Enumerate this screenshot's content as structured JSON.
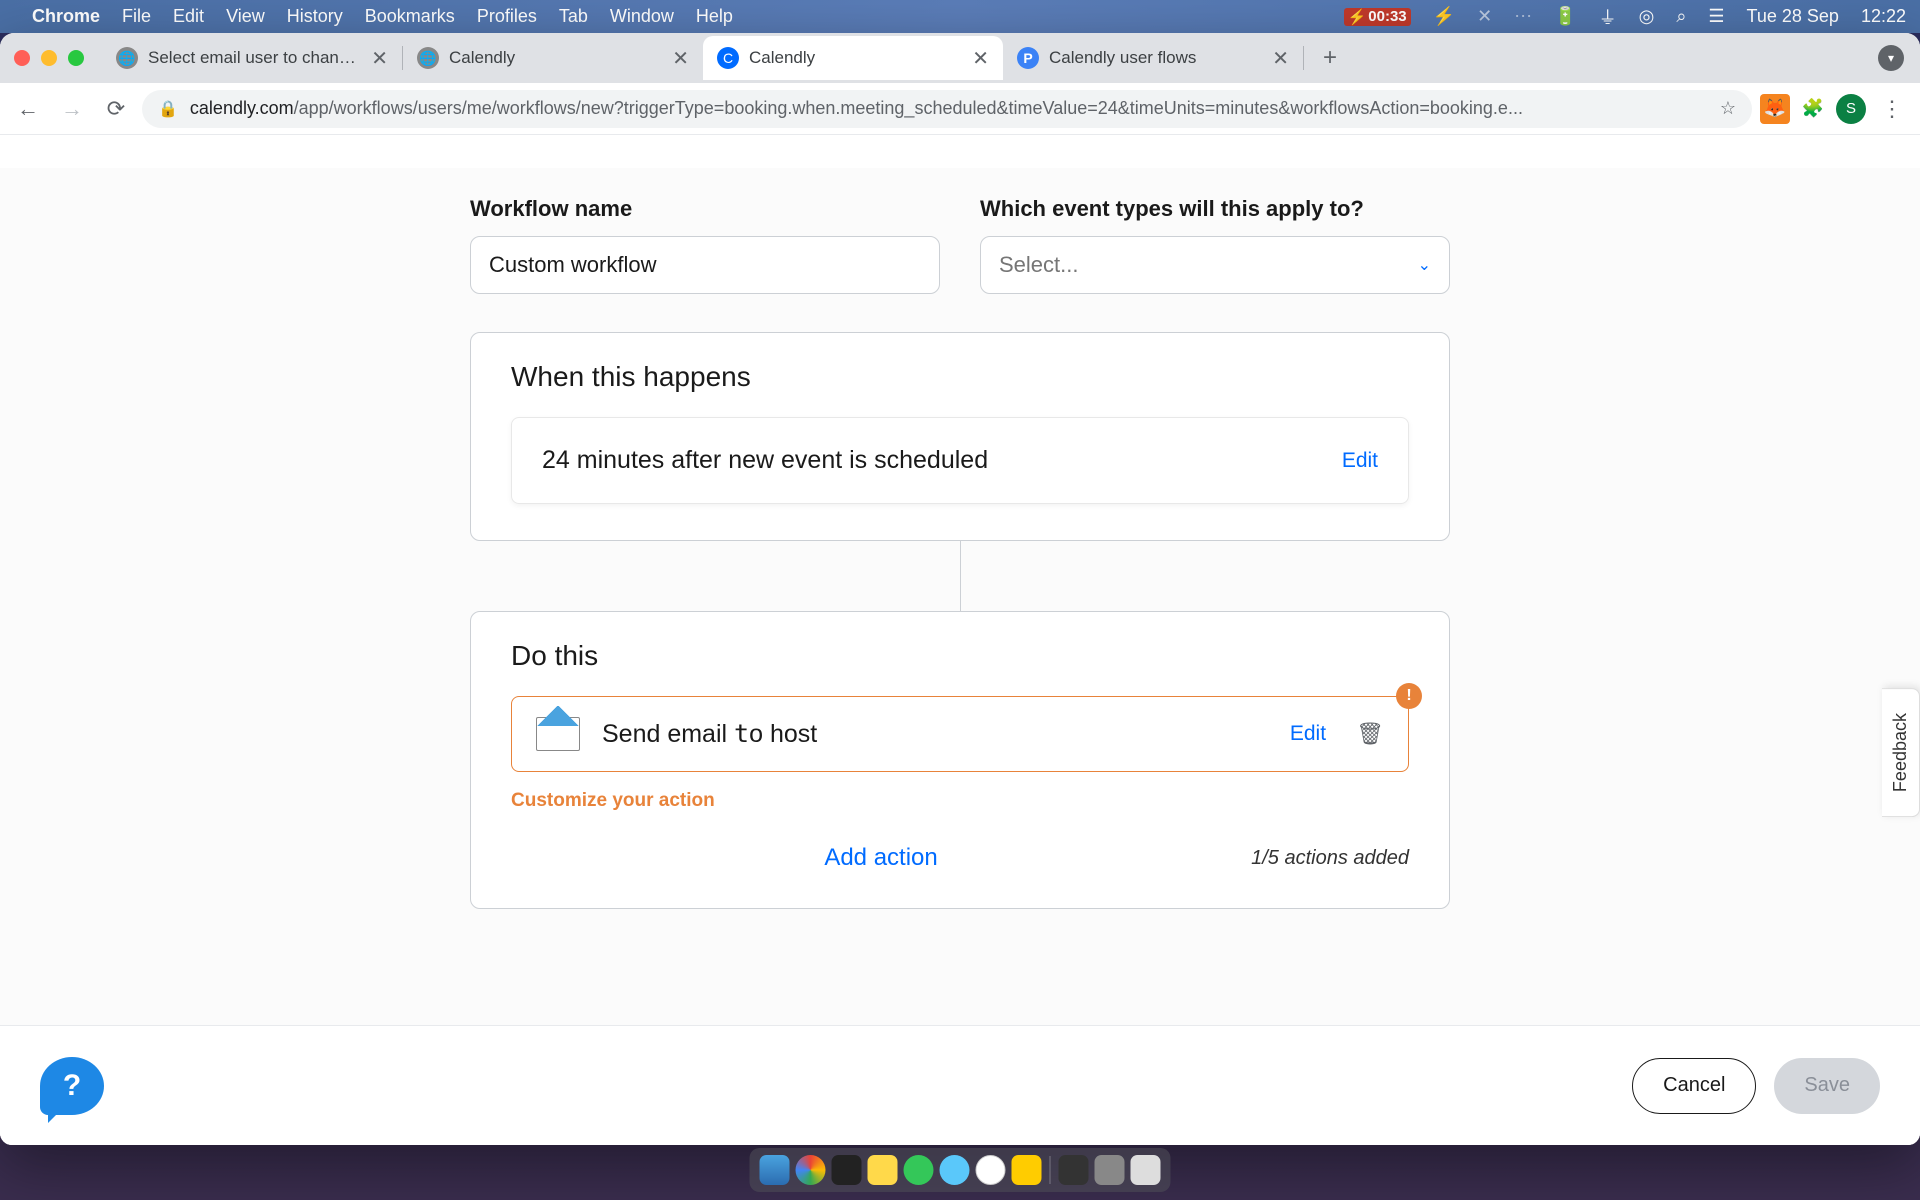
{
  "menubar": {
    "appname": "Chrome",
    "items": [
      "File",
      "Edit",
      "View",
      "History",
      "Bookmarks",
      "Profiles",
      "Tab",
      "Window",
      "Help"
    ],
    "battery": "00:33",
    "date": "Tue 28 Sep",
    "time": "12:22"
  },
  "tabs": [
    {
      "title": "Select email user to change | D",
      "favicon": "globe",
      "active": false
    },
    {
      "title": "Calendly",
      "favicon": "globe",
      "active": false
    },
    {
      "title": "Calendly",
      "favicon": "calendly",
      "active": true
    },
    {
      "title": "Calendly user flows",
      "favicon": "p",
      "active": false
    }
  ],
  "url": {
    "domain": "calendly.com",
    "path": "/app/workflows/users/me/workflows/new?triggerType=booking.when.meeting_scheduled&timeValue=24&timeUnits=minutes&workflowsAction=booking.e..."
  },
  "profile_initial": "S",
  "form": {
    "name_label": "Workflow name",
    "name_value": "Custom workflow",
    "apply_label": "Which event types will this apply to?",
    "apply_placeholder": "Select..."
  },
  "trigger": {
    "heading": "When this happens",
    "text": "24 minutes after new event is scheduled",
    "edit": "Edit"
  },
  "action": {
    "heading": "Do this",
    "text_before": "Send email ",
    "text_caret": "t",
    "text_after": "o host",
    "edit": "Edit",
    "customize": "Customize your action",
    "add": "Add action",
    "count": "1/5 actions added",
    "badge": "!"
  },
  "footer": {
    "help": "?",
    "cancel": "Cancel",
    "save": "Save"
  },
  "feedback": "Feedback"
}
